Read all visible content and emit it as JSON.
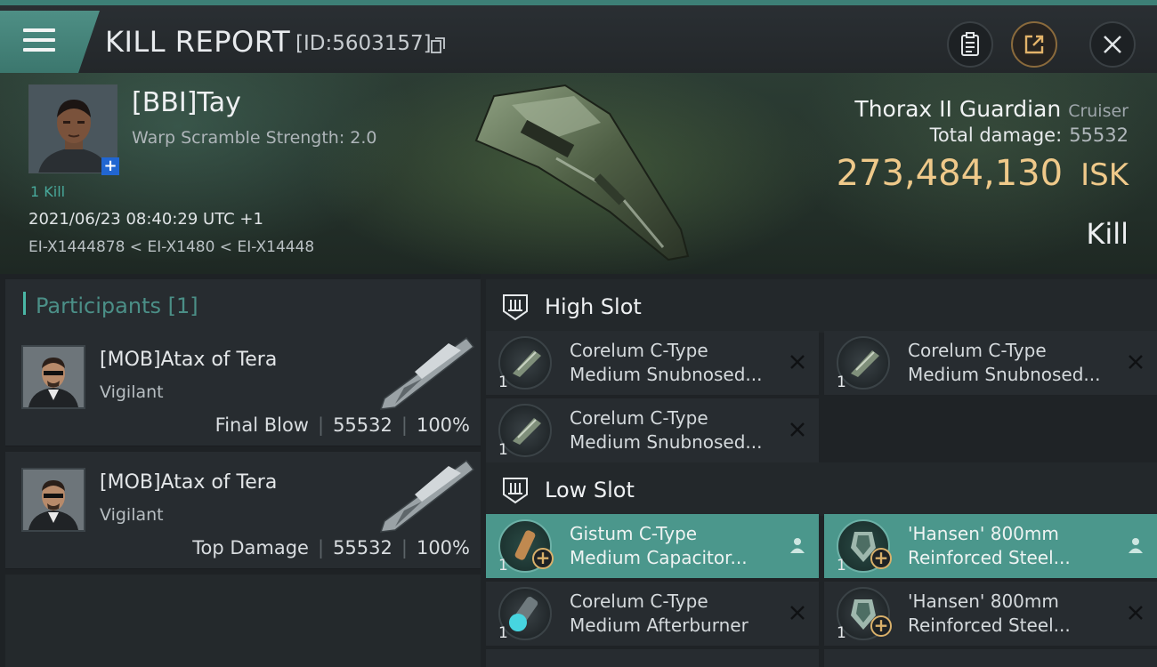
{
  "header": {
    "title": "KILL REPORT",
    "report_id": "[ID:5603157]",
    "icons": [
      "menu-icon",
      "copy-icon",
      "clipboard-icon",
      "share-icon",
      "close-icon"
    ]
  },
  "victim": {
    "name": "[BBI]Tay",
    "warp_scramble": "Warp Scramble Strength: 2.0",
    "kills": "1 Kill",
    "datetime": "2021/06/23 08:40:29 UTC +1",
    "location": "EI-X1444878 < EI-X1480 < EI-X14448",
    "ship_name": "Thorax II Guardian",
    "ship_class": "Cruiser",
    "total_damage_label": "Total damage:",
    "total_damage": "55532",
    "isk_value": "273,484,130",
    "isk_unit": "ISK",
    "outcome": "Kill"
  },
  "participants": {
    "label": "Participants [1]",
    "items": [
      {
        "name": "[MOB]Atax of Tera",
        "ship": "Vigilant",
        "role": "Final Blow",
        "damage": "55532",
        "percent": "100%"
      },
      {
        "name": "[MOB]Atax of Tera",
        "ship": "Vigilant",
        "role": "Top Damage",
        "damage": "55532",
        "percent": "100%"
      }
    ]
  },
  "fitting": {
    "high_slot": {
      "label": "High Slot",
      "modules": [
        {
          "qty": "1",
          "line1": "Corelum C-Type",
          "line2": "Medium Snubnosed...",
          "status": "destroyed"
        },
        {
          "qty": "1",
          "line1": "Corelum C-Type",
          "line2": "Medium Snubnosed...",
          "status": "destroyed"
        },
        {
          "qty": "1",
          "line1": "Corelum C-Type",
          "line2": "Medium Snubnosed...",
          "status": "destroyed"
        }
      ]
    },
    "low_slot": {
      "label": "Low Slot",
      "modules": [
        {
          "qty": "1",
          "line1": "Gistum C-Type",
          "line2": "Medium Capacitor...",
          "status": "dropped"
        },
        {
          "qty": "1",
          "line1": "'Hansen' 800mm",
          "line2": "Reinforced Steel...",
          "status": "dropped"
        },
        {
          "qty": "1",
          "line1": "Corelum C-Type",
          "line2": "Medium Afterburner",
          "status": "destroyed"
        },
        {
          "qty": "1",
          "line1": "'Hansen' 800mm",
          "line2": "Reinforced Steel...",
          "status": "destroyed"
        }
      ]
    }
  },
  "colors": {
    "accent": "#4b978c",
    "isk": "#efc98a",
    "topbar": "#3d7f76"
  }
}
